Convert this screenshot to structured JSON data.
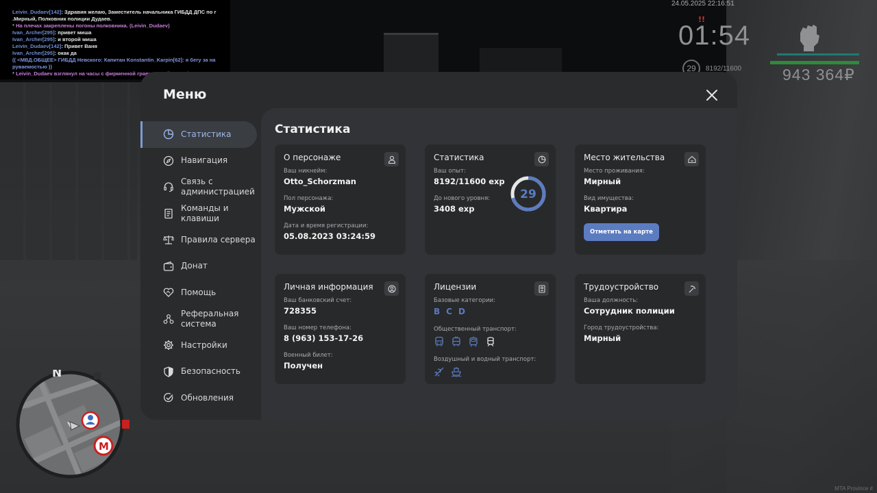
{
  "chat": [
    {
      "name": "Leivin_Dudaev[142]",
      "text": ": Здравия желаю, Заместитель начальника ГИБДД ДПС по г"
    },
    {
      "name": "",
      "text": ".Мирный, Полковник полиции Дудаев."
    },
    {
      "name": "",
      "pink": "* На плечах закреплены погоны полковника. (Leivin_Dudaev)"
    },
    {
      "name": "Ivan_Archer[295]",
      "text": ": привет миша"
    },
    {
      "name": "Ivan_Archer[295]",
      "text": ": и второй миша"
    },
    {
      "name": "Leivin_Dudaev[142]",
      "text": ": Привет Ваня"
    },
    {
      "name": "Ivan_Archer[295]",
      "text": ": окак да"
    },
    {
      "name": "",
      "blue": "(( <МВД.ОБЩЕЕ> ГИБДД Невского: Капитан Konstantin_Karpin[62]: я бегу за на"
    },
    {
      "name": "",
      "blue": "руваемостью ))"
    },
    {
      "name": "",
      "pink": "* Leivin_Dudaev взглянул на часы с фирменной гравировкой \"Gucci\""
    }
  ],
  "hud": {
    "date": "24.05.2025 22:16:51",
    "time": "01:54",
    "warning": "!!",
    "level": "29",
    "exp": "8192/11600",
    "money": "943 364₽",
    "watermark": "MTA Province #",
    "minimap_north": "N",
    "metro": "М"
  },
  "menu": {
    "title": "Меню",
    "close_icon": "close-icon",
    "nav": [
      {
        "label": "Статистика",
        "icon": "pie-chart-icon",
        "active": true
      },
      {
        "label": "Навигация",
        "icon": "compass-icon"
      },
      {
        "label": "Связь с администрацией",
        "icon": "headset-icon"
      },
      {
        "label": "Команды и клавиши",
        "icon": "document-icon"
      },
      {
        "label": "Правила сервера",
        "icon": "scales-icon"
      },
      {
        "label": "Донат",
        "icon": "wallet-icon"
      },
      {
        "label": "Помощь",
        "icon": "heart-handshake-icon"
      },
      {
        "label": "Реферальная система",
        "icon": "network-icon"
      },
      {
        "label": "Настройки",
        "icon": "gear-icon"
      },
      {
        "label": "Безопасность",
        "icon": "shield-icon"
      },
      {
        "label": "Обновления",
        "icon": "check-circle-icon"
      }
    ],
    "content_title": "Статистика",
    "cards": {
      "character": {
        "title": "О персонаже",
        "icon": "user-icon",
        "nickname_label": "Ваш никнейм:",
        "nickname": "Otto_Schorzman",
        "gender_label": "Пол персонажа:",
        "gender": "Мужской",
        "reg_label": "Дата и время регистрации:",
        "reg": "05.08.2023 03:24:59"
      },
      "stats": {
        "title": "Статистика",
        "icon": "clock-pie-icon",
        "exp_label": "Ваш опыт:",
        "exp": "8192/11600 exp",
        "next_label": "До нового уровня:",
        "next": "3408 exp",
        "level": "29",
        "progress": 0.706
      },
      "residence": {
        "title": "Место жительства",
        "icon": "home-icon",
        "place_label": "Место проживания:",
        "place": "Мирный",
        "type_label": "Вид имущества:",
        "type": "Квартира",
        "button": "Отметить на карте"
      },
      "personal": {
        "title": "Личная информация",
        "icon": "user-circle-icon",
        "bank_label": "Ваш банковский счет:",
        "bank": "728355",
        "phone_label": "Ваш номер телефона:",
        "phone": "8 (963) 153-17-26",
        "military_label": "Военный билет:",
        "military": "Получен"
      },
      "licenses": {
        "title": "Лицензии",
        "icon": "id-card-icon",
        "base_label": "Базовые категории:",
        "categories": [
          "B",
          "C",
          "D"
        ],
        "public_label": "Общественный транспорт:",
        "air_label": "Воздушный и водный транспорт:"
      },
      "job": {
        "title": "Трудоустройство",
        "icon": "pickaxe-icon",
        "position_label": "Ваша должность:",
        "position": "Сотрудник полиции",
        "city_label": "Город трудоустройства:",
        "city": "Мирный"
      }
    }
  },
  "colors": {
    "accent": "#5b7cc1",
    "panel": "#2a2b2d",
    "card": "#28292b"
  }
}
